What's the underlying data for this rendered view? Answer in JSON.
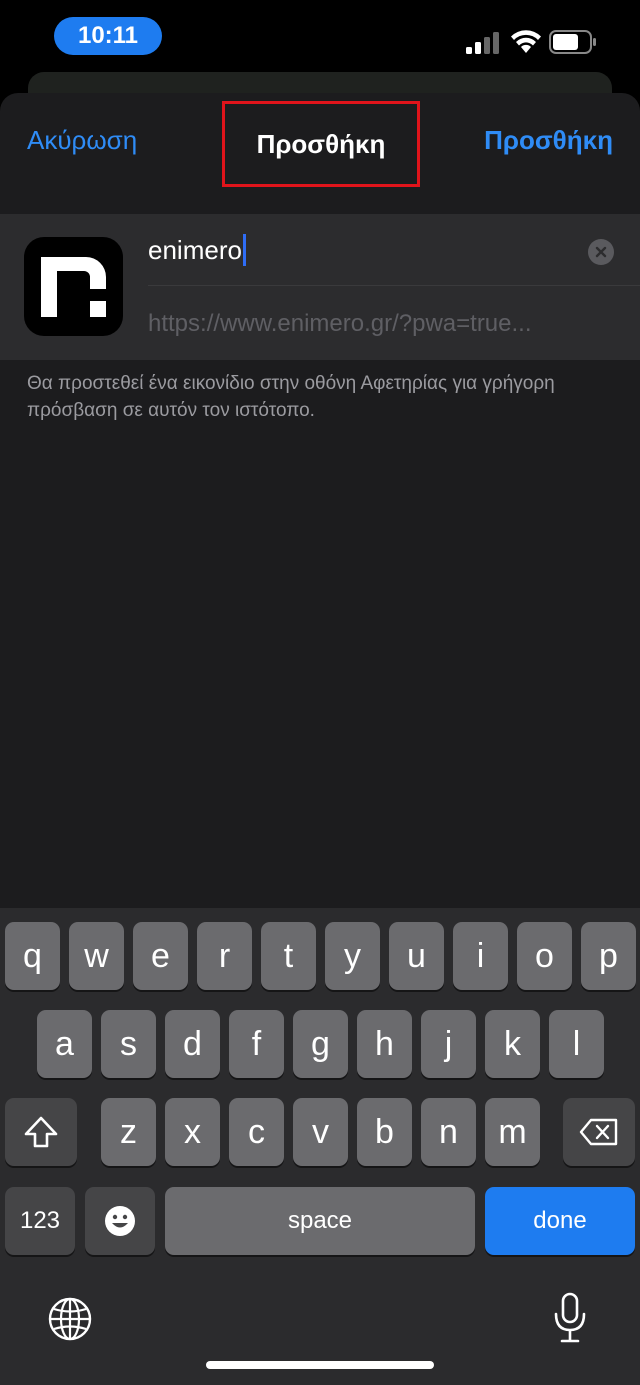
{
  "status_bar": {
    "time": "10:11"
  },
  "nav": {
    "cancel_label": "Ακύρωση",
    "title": "Προσθήκη",
    "add_label": "Προσθήκη"
  },
  "form": {
    "name_value": "enimero",
    "url_value": "https://www.enimero.gr/?pwa=true..."
  },
  "hint_text": "Θα προστεθεί ένα εικονίδιο στην οθόνη Αφετηρίας για γρήγορη πρόσβαση σε αυτόν τον ιστότοπο.",
  "keyboard": {
    "row1": [
      "q",
      "w",
      "e",
      "r",
      "t",
      "y",
      "u",
      "i",
      "o",
      "p"
    ],
    "row2": [
      "a",
      "s",
      "d",
      "f",
      "g",
      "h",
      "j",
      "k",
      "l"
    ],
    "row3": [
      "z",
      "x",
      "c",
      "v",
      "b",
      "n",
      "m"
    ],
    "numbers_label": "123",
    "space_label": "space",
    "done_label": "done"
  },
  "colors": {
    "accent": "#2f8cf6",
    "highlight_border": "#e0141b",
    "done_key": "#1e7cf0"
  },
  "icons": [
    "signal-icon",
    "wifi-icon",
    "battery-icon",
    "clear-icon",
    "shift-icon",
    "delete-icon",
    "emoji-icon",
    "globe-icon",
    "microphone-icon",
    "enimero-logo-icon"
  ]
}
